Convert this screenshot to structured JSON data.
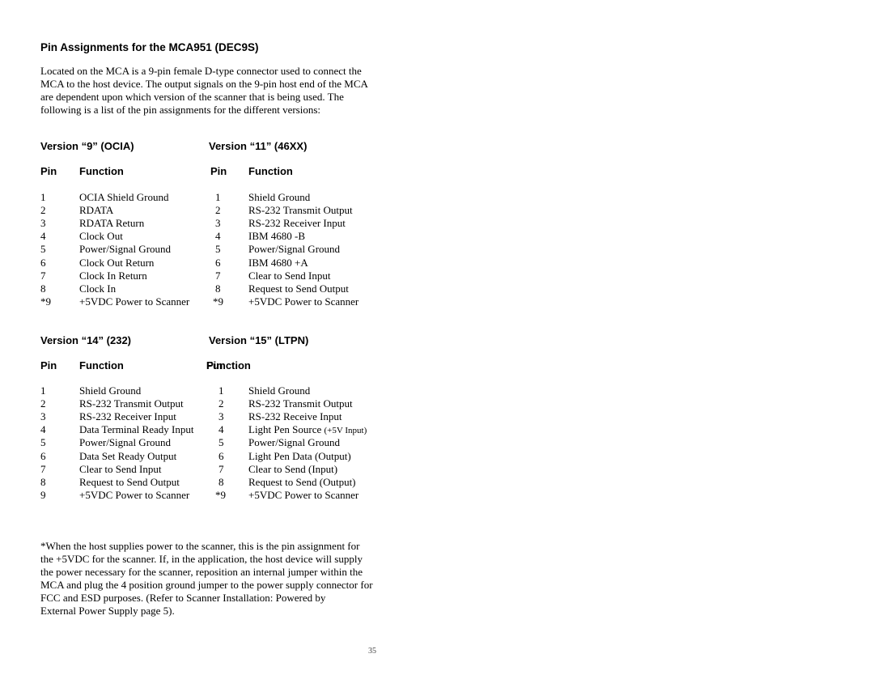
{
  "title": "Pin Assignments for the MCA951 (DEC9S)",
  "intro_lines": [
    "Located on the MCA is a 9-pin female D-type connector used to connect the",
    "MCA to the host device. The output signals on the 9-pin host end of the MCA",
    "are dependent upon which version of the scanner that is being used. The",
    "following is a list of the pin assignments for the different versions:"
  ],
  "tables": [
    {
      "heading": "Version “9” (OCIA)",
      "pin_header": "Pin",
      "function_header": "Function",
      "rows": [
        {
          "pin": "1",
          "function": "OCIA Shield Ground"
        },
        {
          "pin": "2",
          "function": "RDATA"
        },
        {
          "pin": "3",
          "function": "RDATA Return"
        },
        {
          "pin": "4",
          "function": "Clock Out"
        },
        {
          "pin": "5",
          "function": "Power/Signal Ground"
        },
        {
          "pin": "6",
          "function": "Clock Out Return"
        },
        {
          "pin": "7",
          "function": "Clock In Return"
        },
        {
          "pin": "8",
          "function": "Clock In"
        },
        {
          "pin": "*9",
          "function": "+5VDC Power to Scanner"
        }
      ]
    },
    {
      "heading": "Version “11” (46XX)",
      "pin_header": "Pin",
      "function_header": "Function",
      "rows": [
        {
          "pin": "1",
          "function": "Shield Ground"
        },
        {
          "pin": "2",
          "function": "RS-232 Transmit Output"
        },
        {
          "pin": "3",
          "function": "RS-232 Receiver Input"
        },
        {
          "pin": "4",
          "function": "IBM 4680 -B"
        },
        {
          "pin": "5",
          "function": "Power/Signal Ground"
        },
        {
          "pin": "6",
          "function": "IBM 4680 +A"
        },
        {
          "pin": "7",
          "function": "Clear to Send Input"
        },
        {
          "pin": "8",
          "function": "Request to Send Output"
        },
        {
          "pin": "*9",
          "function": "+5VDC Power to Scanner"
        }
      ]
    },
    {
      "heading": "Version “14” (232)",
      "pin_header": "Pin",
      "function_header": "Function",
      "rows": [
        {
          "pin": "1",
          "function": "Shield Ground"
        },
        {
          "pin": "2",
          "function": "RS-232 Transmit Output"
        },
        {
          "pin": "3",
          "function": "RS-232 Receiver Input"
        },
        {
          "pin": "4",
          "function": "Data Terminal Ready Input"
        },
        {
          "pin": "5",
          "function": "Power/Signal Ground"
        },
        {
          "pin": "6",
          "function": "Data Set Ready Output"
        },
        {
          "pin": "7",
          "function": "Clear to Send Input"
        },
        {
          "pin": "8",
          "function": "Request to Send Output"
        },
        {
          "pin": "9",
          "function": "+5VDC Power to Scanner"
        }
      ]
    },
    {
      "heading": "Version “15” (LTPN)",
      "pin_header": "Pin",
      "function_header": "Function",
      "rows": [
        {
          "pin": "1",
          "function": "Shield Ground"
        },
        {
          "pin": "2",
          "function": "RS-232 Transmit Output"
        },
        {
          "pin": "3",
          "function": "RS-232 Receive Input"
        },
        {
          "pin": "4",
          "function": "Light Pen Source ",
          "function_small": "(+5V Input)"
        },
        {
          "pin": "5",
          "function": "Power/Signal Ground"
        },
        {
          "pin": "6",
          "function": "Light Pen Data (Output)"
        },
        {
          "pin": "7",
          "function": "Clear to Send (Input)"
        },
        {
          "pin": "8",
          "function": "Request to Send (Output)"
        },
        {
          "pin": "*9",
          "function": "+5VDC Power to Scanner"
        }
      ]
    }
  ],
  "footnote_lines": [
    "*When the host supplies power to the scanner, this is the pin assignment for",
    "the +5VDC for the scanner. If, in the application, the host device will supply",
    "the power necessary for the scanner, reposition an internal jumper within the",
    "MCA and plug the 4 position ground jumper to the power supply connector for",
    "FCC and ESD purposes. (Refer to Scanner Installation: Powered by",
    "External Power Supply page 5)."
  ],
  "page_number": "35"
}
